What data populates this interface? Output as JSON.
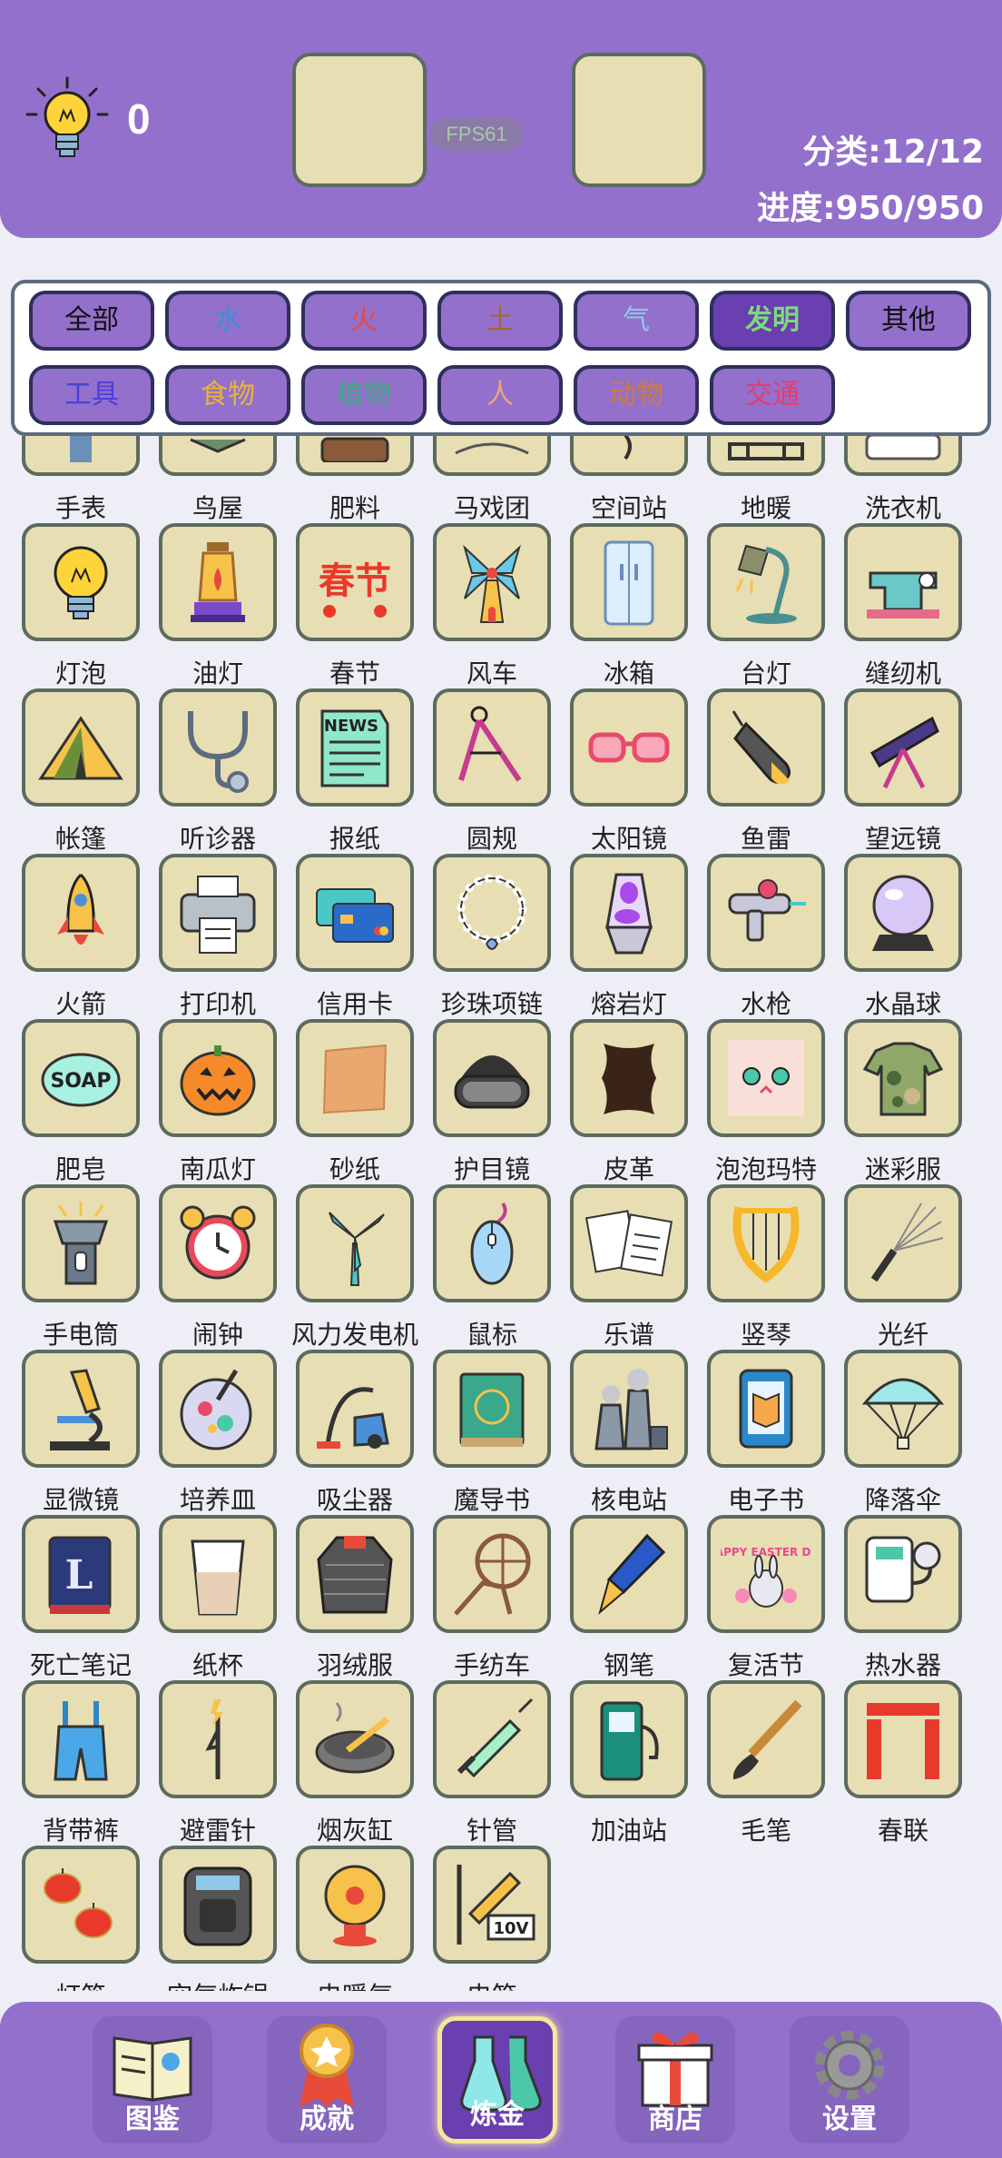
{
  "header": {
    "hint_count": "0",
    "fps": "FPS61",
    "category_stat": "分类:12/12",
    "progress_stat": "进度:950/950"
  },
  "filters": [
    {
      "label": "全部",
      "color": "#111111",
      "active": false
    },
    {
      "label": "水",
      "color": "#3B8FD8",
      "active": false
    },
    {
      "label": "火",
      "color": "#E84A3A",
      "active": false
    },
    {
      "label": "土",
      "color": "#A8663A",
      "active": false
    },
    {
      "label": "气",
      "color": "#8FC7E8",
      "active": false
    },
    {
      "label": "发明",
      "color": "#7FD97F",
      "active": true
    },
    {
      "label": "其他",
      "color": "#111111",
      "active": false
    },
    {
      "label": "工具",
      "color": "#4A3FD8",
      "active": false
    },
    {
      "label": "食物",
      "color": "#E8B43A",
      "active": false
    },
    {
      "label": "植物",
      "color": "#3FA87F",
      "active": false
    },
    {
      "label": "人",
      "color": "#F0A07A",
      "active": false
    },
    {
      "label": "动物",
      "color": "#D07A3A",
      "active": false
    },
    {
      "label": "交通",
      "color": "#E83A6A",
      "active": false
    }
  ],
  "items": [
    {
      "name": "手表",
      "icon": "watch-icon"
    },
    {
      "name": "鸟屋",
      "icon": "birdhouse-icon"
    },
    {
      "name": "肥料",
      "icon": "fertilizer-icon"
    },
    {
      "name": "马戏团",
      "icon": "circus-icon"
    },
    {
      "name": "空间站",
      "icon": "space-station-icon"
    },
    {
      "name": "地暖",
      "icon": "floor-heating-icon"
    },
    {
      "name": "洗衣机",
      "icon": "washing-machine-icon"
    },
    {
      "name": "灯泡",
      "icon": "light-bulb-icon"
    },
    {
      "name": "油灯",
      "icon": "oil-lamp-icon"
    },
    {
      "name": "春节",
      "icon": "spring-festival-icon"
    },
    {
      "name": "风车",
      "icon": "windmill-icon"
    },
    {
      "name": "冰箱",
      "icon": "fridge-icon"
    },
    {
      "name": "台灯",
      "icon": "desk-lamp-icon"
    },
    {
      "name": "缝纫机",
      "icon": "sewing-machine-icon"
    },
    {
      "name": "帐篷",
      "icon": "tent-icon"
    },
    {
      "name": "听诊器",
      "icon": "stethoscope-icon"
    },
    {
      "name": "报纸",
      "icon": "newspaper-icon"
    },
    {
      "name": "圆规",
      "icon": "compass-icon"
    },
    {
      "name": "太阳镜",
      "icon": "sunglasses-icon"
    },
    {
      "name": "鱼雷",
      "icon": "torpedo-icon"
    },
    {
      "name": "望远镜",
      "icon": "telescope-icon"
    },
    {
      "name": "火箭",
      "icon": "rocket-icon"
    },
    {
      "name": "打印机",
      "icon": "printer-icon"
    },
    {
      "name": "信用卡",
      "icon": "credit-card-icon"
    },
    {
      "name": "珍珠项链",
      "icon": "pearl-necklace-icon"
    },
    {
      "name": "熔岩灯",
      "icon": "lava-lamp-icon"
    },
    {
      "name": "水枪",
      "icon": "water-gun-icon"
    },
    {
      "name": "水晶球",
      "icon": "crystal-ball-icon"
    },
    {
      "name": "肥皂",
      "icon": "soap-icon"
    },
    {
      "name": "南瓜灯",
      "icon": "pumpkin-lantern-icon"
    },
    {
      "name": "砂纸",
      "icon": "sandpaper-icon"
    },
    {
      "name": "护目镜",
      "icon": "goggles-icon"
    },
    {
      "name": "皮革",
      "icon": "leather-icon"
    },
    {
      "name": "泡泡玛特",
      "icon": "pop-mart-icon"
    },
    {
      "name": "迷彩服",
      "icon": "camouflage-icon"
    },
    {
      "name": "手电筒",
      "icon": "flashlight-icon"
    },
    {
      "name": "闹钟",
      "icon": "alarm-clock-icon"
    },
    {
      "name": "风力发电机",
      "icon": "wind-turbine-icon"
    },
    {
      "name": "鼠标",
      "icon": "mouse-icon"
    },
    {
      "name": "乐谱",
      "icon": "sheet-music-icon"
    },
    {
      "name": "竖琴",
      "icon": "harp-icon"
    },
    {
      "name": "光纤",
      "icon": "optical-fiber-icon"
    },
    {
      "name": "显微镜",
      "icon": "microscope-icon"
    },
    {
      "name": "培养皿",
      "icon": "petri-dish-icon"
    },
    {
      "name": "吸尘器",
      "icon": "vacuum-cleaner-icon"
    },
    {
      "name": "魔导书",
      "icon": "grimoire-icon"
    },
    {
      "name": "核电站",
      "icon": "nuclear-plant-icon"
    },
    {
      "name": "电子书",
      "icon": "ebook-icon"
    },
    {
      "name": "降落伞",
      "icon": "parachute-icon"
    },
    {
      "name": "死亡笔记",
      "icon": "death-note-icon"
    },
    {
      "name": "纸杯",
      "icon": "paper-cup-icon"
    },
    {
      "name": "羽绒服",
      "icon": "down-jacket-icon"
    },
    {
      "name": "手纺车",
      "icon": "spinning-wheel-icon"
    },
    {
      "name": "钢笔",
      "icon": "fountain-pen-icon"
    },
    {
      "name": "复活节",
      "icon": "easter-icon"
    },
    {
      "name": "热水器",
      "icon": "water-heater-icon"
    },
    {
      "name": "背带裤",
      "icon": "overalls-icon"
    },
    {
      "name": "避雷针",
      "icon": "lightning-rod-icon"
    },
    {
      "name": "烟灰缸",
      "icon": "ashtray-icon"
    },
    {
      "name": "针管",
      "icon": "syringe-icon"
    },
    {
      "name": "加油站",
      "icon": "gas-station-icon"
    },
    {
      "name": "毛笔",
      "icon": "brush-icon"
    },
    {
      "name": "春联",
      "icon": "couplets-icon"
    },
    {
      "name": "灯笼",
      "icon": "lantern-icon"
    },
    {
      "name": "空气炸锅",
      "icon": "air-fryer-icon"
    },
    {
      "name": "电暖气",
      "icon": "heater-icon"
    },
    {
      "name": "电笔",
      "icon": "test-pen-icon"
    }
  ],
  "icon_texts": {
    "spring_festival": "春节",
    "newspaper": "NEWS",
    "soap": "SOAP",
    "test_pen": "10V",
    "easter": "HAPPY EASTER DAY"
  },
  "nav": [
    {
      "label": "图鉴",
      "icon": "book-icon",
      "active": false
    },
    {
      "label": "成就",
      "icon": "medal-icon",
      "active": false
    },
    {
      "label": "炼金",
      "icon": "flask-icon",
      "active": true
    },
    {
      "label": "商店",
      "icon": "gift-icon",
      "active": false
    },
    {
      "label": "设置",
      "icon": "gear-icon",
      "active": false
    }
  ],
  "colors": {
    "purple": "#9370CC",
    "active_purple": "#6A3FB0",
    "tile_fill": "#E8DEB4",
    "tile_border": "#5C6B5E",
    "background": "#EEEEF6"
  }
}
